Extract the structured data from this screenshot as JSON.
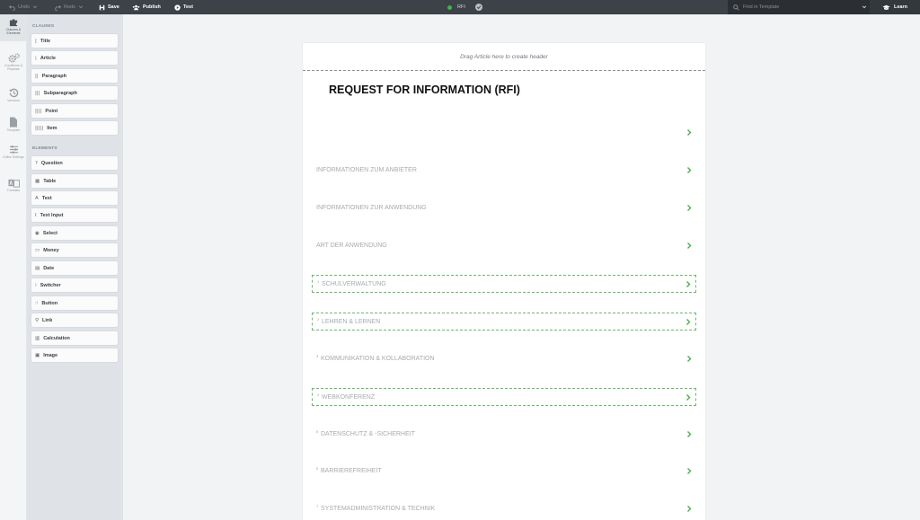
{
  "toolbar": {
    "undo": "Undo",
    "redo": "Redo",
    "save": "Save",
    "publish": "Publish",
    "test": "Test",
    "doc_name": "RFI",
    "status_color": "#3cb54a",
    "search_placeholder": "Find in Template",
    "learn": "Learn"
  },
  "rail": [
    {
      "label": "Clauses & Elements",
      "icon": "puzzle-icon",
      "active": true
    },
    {
      "label": "Conditions & Repeats",
      "icon": "gears-icon",
      "active": false
    },
    {
      "label": "Versions",
      "icon": "history-icon",
      "active": false
    },
    {
      "label": "Template",
      "icon": "file-icon",
      "active": false
    },
    {
      "label": "Editor Settings",
      "icon": "sliders-icon",
      "active": false
    },
    {
      "label": "Translate",
      "icon": "translate-icon",
      "active": false
    }
  ],
  "palette": {
    "clauses_heading": "CLAUSES",
    "clauses": [
      {
        "label": "Title",
        "icon": "|"
      },
      {
        "label": "Article",
        "icon": "¦"
      },
      {
        "label": "Paragraph",
        "icon": "||"
      },
      {
        "label": "Subparagraph",
        "icon": "|||"
      },
      {
        "label": "Point",
        "icon": "||||"
      },
      {
        "label": "Item",
        "icon": "|||||"
      }
    ],
    "elements_heading": "ELEMENTS",
    "elements": [
      {
        "label": "Question",
        "icon": "?"
      },
      {
        "label": "Table",
        "icon": "▦"
      },
      {
        "label": "Text",
        "icon": "A"
      },
      {
        "label": "Text Input",
        "icon": "I"
      },
      {
        "label": "Select",
        "icon": "◉"
      },
      {
        "label": "Money",
        "icon": "▭"
      },
      {
        "label": "Date",
        "icon": "▤"
      },
      {
        "label": "Switcher",
        "icon": "⁞"
      },
      {
        "label": "Button",
        "icon": "☝"
      },
      {
        "label": "Link",
        "icon": "⚲"
      },
      {
        "label": "Calculation",
        "icon": "▥"
      },
      {
        "label": "Image",
        "icon": "▣"
      }
    ]
  },
  "document": {
    "header_placeholder": "Drag Article here to create header",
    "title": "REQUEST FOR INFORMATION (RFI)",
    "articles": [
      {
        "num": "",
        "label": "",
        "boxed": false
      },
      {
        "num": "",
        "label": "INFORMATIONEN ZUM ANBIETER",
        "boxed": false
      },
      {
        "num": "",
        "label": "INFORMATIONEN ZUR ANWENDUNG",
        "boxed": false
      },
      {
        "num": "",
        "label": "ART DER ANWENDUNG",
        "boxed": false
      },
      {
        "num": "1",
        "label": "SCHULVERWALTUNG",
        "boxed": true
      },
      {
        "num": "2",
        "label": "LEHREN & LERNEN",
        "boxed": true
      },
      {
        "num": "3",
        "label": "KOMMUNIKATION & KOLLABORATION",
        "boxed": false
      },
      {
        "num": "4",
        "label": "WEBKONFERENZ",
        "boxed": true
      },
      {
        "num": "5",
        "label": "DATENSCHUTZ & -SICHERHEIT",
        "boxed": false
      },
      {
        "num": "6",
        "label": "BARRIEREFREIHEIT",
        "boxed": false
      },
      {
        "num": "7",
        "label": "SYSTEMADMINISTRATION & TECHNIK",
        "boxed": false
      }
    ],
    "accent_color": "#4caf50"
  }
}
